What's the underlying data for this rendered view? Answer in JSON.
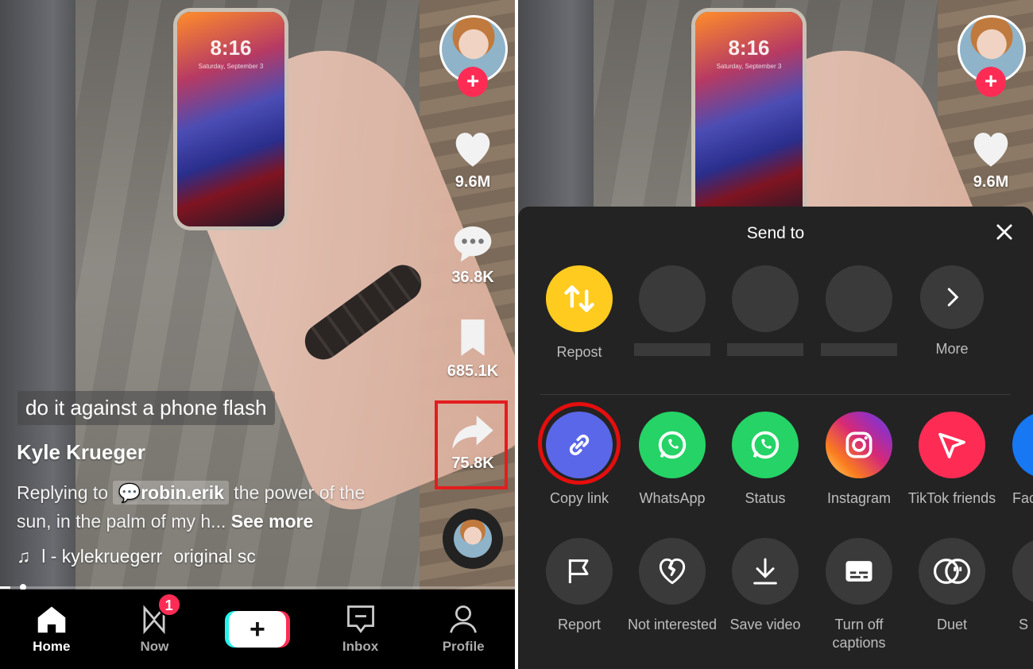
{
  "left": {
    "overlay_text": "do it against a phone flash",
    "phone_clock": "8:16",
    "phone_date": "Saturday, September 3",
    "rail": {
      "likes": "9.6M",
      "comments": "36.8K",
      "saves": "685.1K",
      "shares": "75.8K"
    },
    "username": "Kyle Krueger",
    "description": {
      "prefix": "Replying to",
      "mention": "robin.erik",
      "text": " the power of the sun, in the palm of my h... ",
      "see_more": "See more"
    },
    "music": {
      "artist": "l - kylekruegerr",
      "sound": "original sc"
    },
    "progress": 0.02,
    "nav": {
      "home": "Home",
      "now": "Now",
      "now_badge": "1",
      "create": "+",
      "inbox": "Inbox",
      "profile": "Profile"
    }
  },
  "right": {
    "phone_clock": "8:16",
    "phone_date": "Saturday, September 3",
    "likes": "9.6M",
    "sheet": {
      "title": "Send to",
      "row1": [
        {
          "label": "Repost",
          "icon": "repost-icon"
        },
        {
          "label": "",
          "icon": "contact-placeholder"
        },
        {
          "label": "",
          "icon": "contact-placeholder"
        },
        {
          "label": "",
          "icon": "contact-placeholder"
        },
        {
          "label": "More",
          "icon": "chevron-right-icon"
        }
      ],
      "row2": [
        {
          "label": "Copy link",
          "icon": "link-icon",
          "color": "#5a67e8"
        },
        {
          "label": "WhatsApp",
          "icon": "whatsapp-icon",
          "color": "#25d366"
        },
        {
          "label": "Status",
          "icon": "whatsapp-status-icon",
          "color": "#25d366"
        },
        {
          "label": "Instagram",
          "icon": "instagram-icon",
          "color": "#e1306c"
        },
        {
          "label": "TikTok friends",
          "icon": "send-icon",
          "color": "#fe2c55"
        },
        {
          "label": "Fac",
          "icon": "facebook-icon",
          "color": "#1877f2"
        }
      ],
      "row3": [
        {
          "label": "Report",
          "icon": "flag-icon"
        },
        {
          "label": "Not interested",
          "icon": "broken-heart-icon"
        },
        {
          "label": "Save video",
          "icon": "download-icon"
        },
        {
          "label": "Turn off captions",
          "icon": "captions-icon"
        },
        {
          "label": "Duet",
          "icon": "duet-icon"
        },
        {
          "label": "S",
          "icon": "stitch-icon"
        }
      ]
    }
  },
  "colors": {
    "accent": "#fe2c55",
    "highlight": "#e31d1d",
    "sheet_bg": "#232323",
    "repost": "#ffcb1f"
  }
}
